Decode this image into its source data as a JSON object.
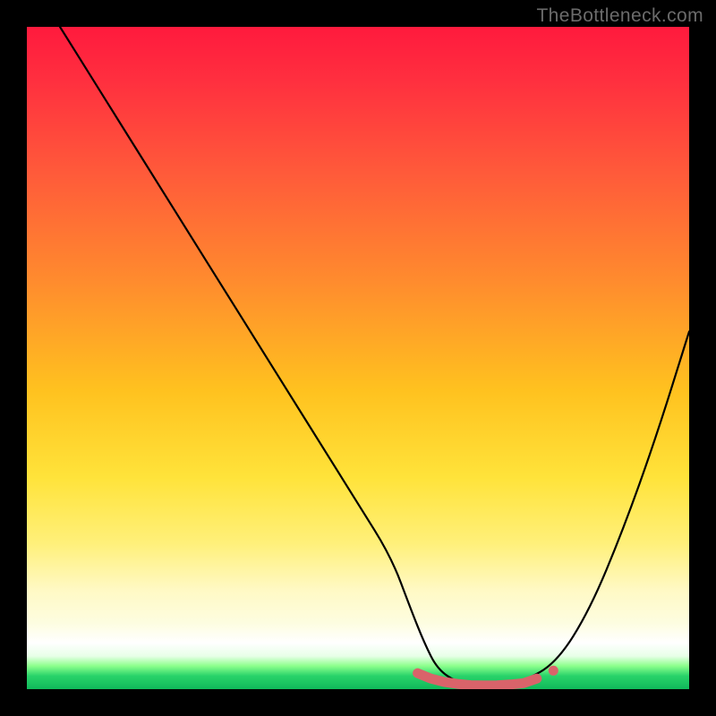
{
  "watermark": "TheBottleneck.com",
  "chart_data": {
    "type": "line",
    "title": "",
    "xlabel": "",
    "ylabel": "",
    "xlim": [
      0,
      100
    ],
    "ylim": [
      0,
      100
    ],
    "series": [
      {
        "name": "bottleneck-curve",
        "x": [
          5,
          10,
          15,
          20,
          25,
          30,
          35,
          40,
          45,
          50,
          55,
          58,
          60,
          62,
          65,
          68,
          70,
          72,
          75,
          80,
          85,
          90,
          95,
          100
        ],
        "y": [
          100,
          92,
          84,
          76,
          68,
          60,
          52,
          44,
          36,
          28,
          20,
          12,
          7,
          3,
          1,
          0.5,
          0.5,
          0.7,
          1.2,
          4,
          12,
          24,
          38,
          54
        ]
      }
    ],
    "markers": {
      "name": "recommended-range",
      "color": "#d9636a",
      "x": [
        59,
        61,
        63,
        65,
        67,
        69,
        71,
        73,
        75,
        77
      ],
      "y": [
        2.4,
        1.6,
        1.1,
        0.8,
        0.6,
        0.55,
        0.58,
        0.7,
        0.9,
        1.6
      ]
    },
    "gradient_stops": [
      {
        "pos": 0,
        "color": "#ff1a3d"
      },
      {
        "pos": 22,
        "color": "#ff5a3a"
      },
      {
        "pos": 55,
        "color": "#ffc21f"
      },
      {
        "pos": 78,
        "color": "#fff07a"
      },
      {
        "pos": 93,
        "color": "#ffffff"
      },
      {
        "pos": 100,
        "color": "#10b85a"
      }
    ]
  }
}
